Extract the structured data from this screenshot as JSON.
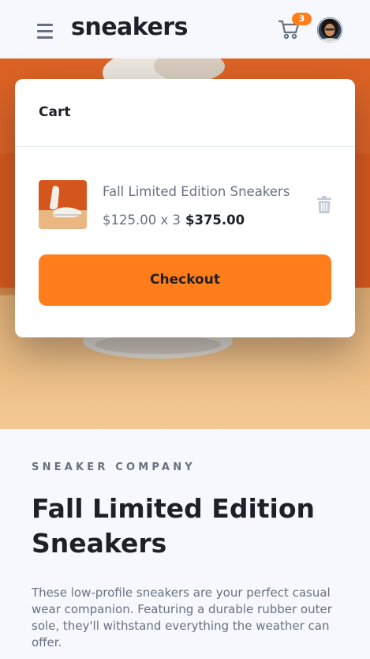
{
  "header": {
    "logo": "sneakers",
    "cart_count": "3"
  },
  "cart": {
    "title": "Cart",
    "item": {
      "name": "Fall Limited Edition Sneakers",
      "unit_price_qty": "$125.00 x 3",
      "total": "$375.00"
    },
    "checkout_label": "Checkout"
  },
  "product": {
    "company": "SNEAKER COMPANY",
    "title": "Fall Limited Edition Sneakers",
    "description": "These low-profile sneakers are your perfect casual wear companion. Featuring a durable rubber outer sole, they'll withstand everything the weather can offer."
  },
  "colors": {
    "accent": "#ff7e1b",
    "text_dark": "#1d2026",
    "text_muted": "#69707d",
    "background": "#f6f8fd"
  },
  "icons": [
    "menu-icon",
    "cart-icon",
    "trash-icon"
  ]
}
